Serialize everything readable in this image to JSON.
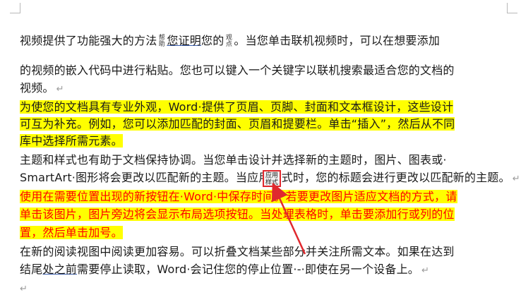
{
  "doc": {
    "p1": {
      "a": "视频提供了功能强大的方法",
      "vert1": "帮助",
      "b": "您证明",
      "c": "您的",
      "vert2": "观点",
      "d": "。当您单击联机视频时，可以在想要添加",
      "l2": "的视频的嵌入代码中进行粘贴。您也可以键入一个关键字以联机搜索最适合您的文档的",
      "l3": "视频。"
    },
    "p2": {
      "l1": "为使您的文档具有专业外观，Word·提供了页眉、页脚、封面和文本框设计，这些设计",
      "l2": "可互为补充。例如，您可以添加匹配的封面、页眉和提要栏。单击“插入”，然后从不同",
      "l3": "库中选择所需元素。"
    },
    "p3": {
      "l1": "主题和样式也有助于文档保持协调。当您单击设计并选择新的主题时，图片、图表或·",
      "l2": "SmartArt·图形将会更改以匹配新的主题。当应用样式时，您的标题会进行更改以匹配新的主题。"
    },
    "p4": {
      "l1": "使用在需要位置出现的新按钮在·Word·中保存时间。若要更改图片适应文档的方式，请",
      "l2": "单击该图片，图片旁边将会显示布局选项按钮。当处理表格时，单击要添加行或列的位",
      "l3": "置，然后单击加号。"
    },
    "p5": {
      "l1": "在新的阅读视图中阅读更加容易。可以折叠文档某些部分并关注所需文本。如果在达到",
      "l2a": "结尾",
      "l2b": "处之前",
      "l2c": "需要停止读取，Word·会记住您的停止位置·-·即使在另一个设备上。"
    },
    "mark": "↵",
    "tag": {
      "l1": "应用",
      "l2": "样式"
    }
  },
  "colors": {
    "highlight": "#ffff00",
    "red_text": "#ff0000",
    "arrow": "#e0282e"
  }
}
